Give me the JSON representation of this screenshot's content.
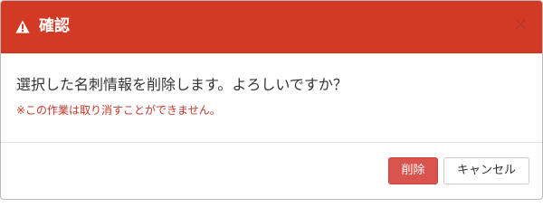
{
  "dialog": {
    "title": "確認",
    "close_label": "×",
    "message": "選択した名刺情報を削除します。よろしいですか？",
    "note": "※この作業は取り消すことができません。",
    "delete_label": "削除",
    "cancel_label": "キャンセル"
  },
  "icons": {
    "title_icon": "warning-triangle-icon",
    "close_icon": "close-icon"
  },
  "colors": {
    "header_bg": "#d23a25",
    "note_text": "#c0392b",
    "delete_button": "#d9534f"
  }
}
